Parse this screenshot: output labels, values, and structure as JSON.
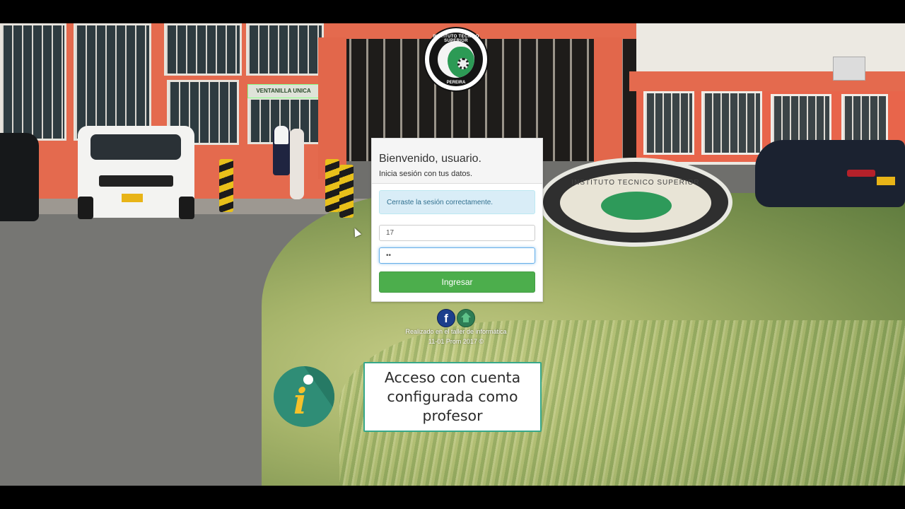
{
  "login": {
    "title": "Bienvenido, usuario.",
    "subtitle": "Inicia sesión con tus datos.",
    "alert": "Cerraste la sesión correctamente.",
    "username_value": "17",
    "password_value": "••",
    "submit_label": "Ingresar"
  },
  "logo": {
    "text_top": "INSTITUTO TECNICO SUPERIOR",
    "text_bottom": "PEREIRA"
  },
  "background": {
    "sign_text": "VENTANILLA UNICA",
    "emblem_text": "INSTITUTO TECNICO SUPERIOR"
  },
  "footer": {
    "line1": "Realizado en el taller de informática",
    "line2": "11-01 Prom 2017 ©",
    "icons": [
      "facebook-icon",
      "home-icon"
    ]
  },
  "overlay": {
    "caption": "Acceso con cuenta configurada como profesor",
    "icon": "info-icon",
    "icon_letter": "i"
  },
  "colors": {
    "accent_green": "#4cae4c",
    "alert_bg": "#d9edf7",
    "info_teal": "#2f8d76"
  }
}
